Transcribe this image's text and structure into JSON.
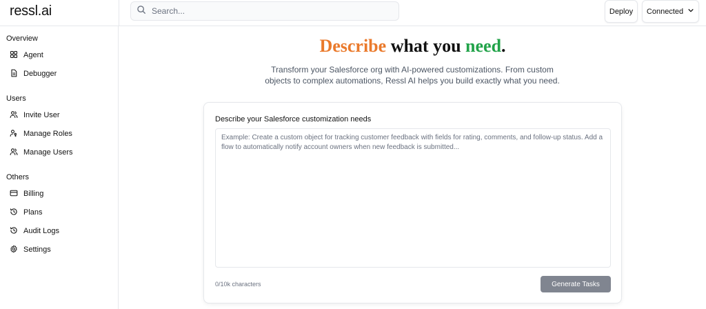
{
  "header": {
    "brand": "ressl.ai",
    "search_placeholder": "Search...",
    "deploy_label": "Deploy",
    "connection_label": "Connected"
  },
  "sidebar": {
    "sections": [
      {
        "title": "Overview",
        "items": [
          {
            "label": "Agent",
            "icon": "grid-icon"
          },
          {
            "label": "Debugger",
            "icon": "document-icon"
          }
        ]
      },
      {
        "title": "Users",
        "items": [
          {
            "label": "Invite User",
            "icon": "users-icon"
          },
          {
            "label": "Manage Roles",
            "icon": "user-key-icon"
          },
          {
            "label": "Manage Users",
            "icon": "users-icon"
          }
        ]
      },
      {
        "title": "Others",
        "items": [
          {
            "label": "Billing",
            "icon": "credit-card-icon"
          },
          {
            "label": "Plans",
            "icon": "history-icon"
          },
          {
            "label": "Audit Logs",
            "icon": "history-icon"
          },
          {
            "label": "Settings",
            "icon": "gear-icon"
          }
        ]
      }
    ]
  },
  "main": {
    "headline": {
      "part1": "Describe",
      "part2": " what you ",
      "part3": "need",
      "part4": "."
    },
    "subtitle": "Transform your Salesforce org with AI-powered customizations. From custom objects to complex automations, Ressl AI helps you build exactly what you need.",
    "card": {
      "label": "Describe your Salesforce customization needs",
      "textarea_placeholder": "Example: Create a custom object for tracking customer feedback with fields for rating, comments, and follow-up status. Add a flow to automatically notify account owners when new feedback is submitted...",
      "textarea_value": "",
      "char_count": "0/10k characters",
      "generate_label": "Generate Tasks"
    }
  },
  "colors": {
    "accent_orange": "#ea7a2c",
    "accent_green": "#22a34a",
    "button_disabled": "#808590"
  }
}
